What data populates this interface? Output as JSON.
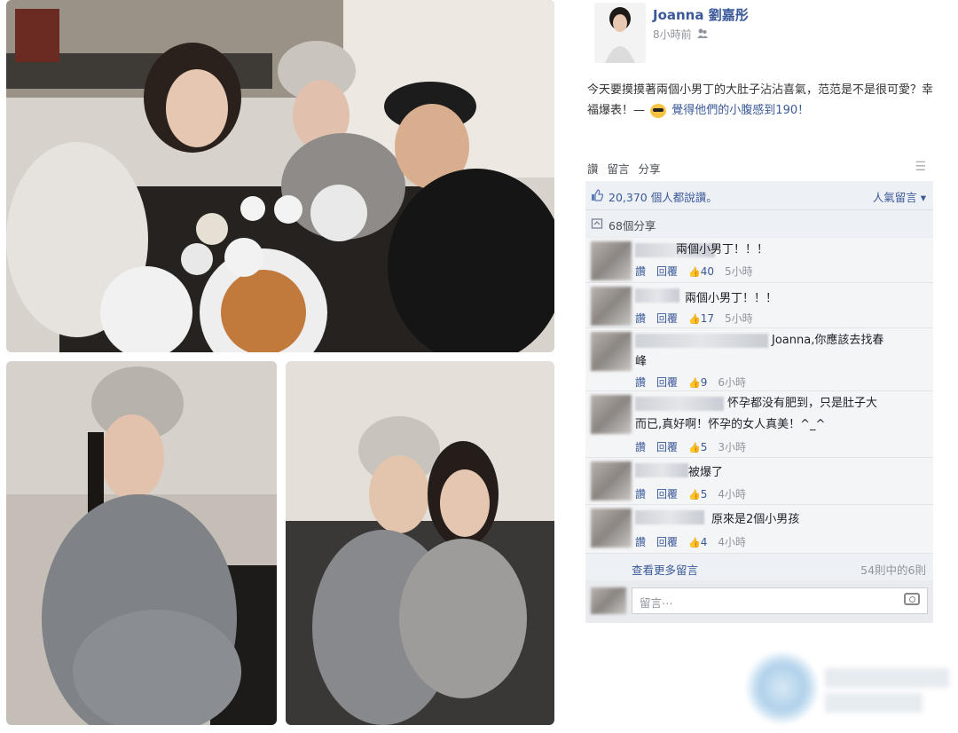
{
  "post": {
    "author": "Joanna 劉嘉彤",
    "time": "8小時前",
    "text_main": "今天要摸摸著兩個小男丁的大肚子沾沾喜氣，范范是不是很可愛？幸福爆表！—",
    "text_feeling": "覺得他們的小腹感到190！"
  },
  "actions": {
    "like": "讚",
    "comment": "留言",
    "share": "分享"
  },
  "stats": {
    "likes": "20,370 個人都說讚。",
    "top_comments": "人氣留言 ▾",
    "shares": "68個分享"
  },
  "comments": [
    {
      "text": "兩個小男丁！！！",
      "like": "讚",
      "reply": "回覆",
      "likes": "40",
      "time": "5小時"
    },
    {
      "text": "兩個小男丁！！！",
      "like": "讚",
      "reply": "回覆",
      "likes": "17",
      "time": "5小時"
    },
    {
      "text_line1": "Joanna,你應該去找春",
      "text_line2": "峰",
      "like": "讚",
      "reply": "回覆",
      "likes": "9",
      "time": "6小時"
    },
    {
      "text_line1": "怀孕都没有肥到，只是肚子大",
      "text_line2": "而已,真好啊！怀孕的女人真美！^_^",
      "like": "讚",
      "reply": "回覆",
      "likes": "5",
      "time": "3小時"
    },
    {
      "text": "被爆了",
      "like": "讚",
      "reply": "回覆",
      "likes": "5",
      "time": "4小時"
    },
    {
      "text": "原來是2個小男孩",
      "like": "讚",
      "reply": "回覆",
      "likes": "4",
      "time": "4小時"
    }
  ],
  "footer": {
    "more": "查看更多留言",
    "count": "54則中的6則",
    "reply_placeholder": "留言⋯"
  }
}
